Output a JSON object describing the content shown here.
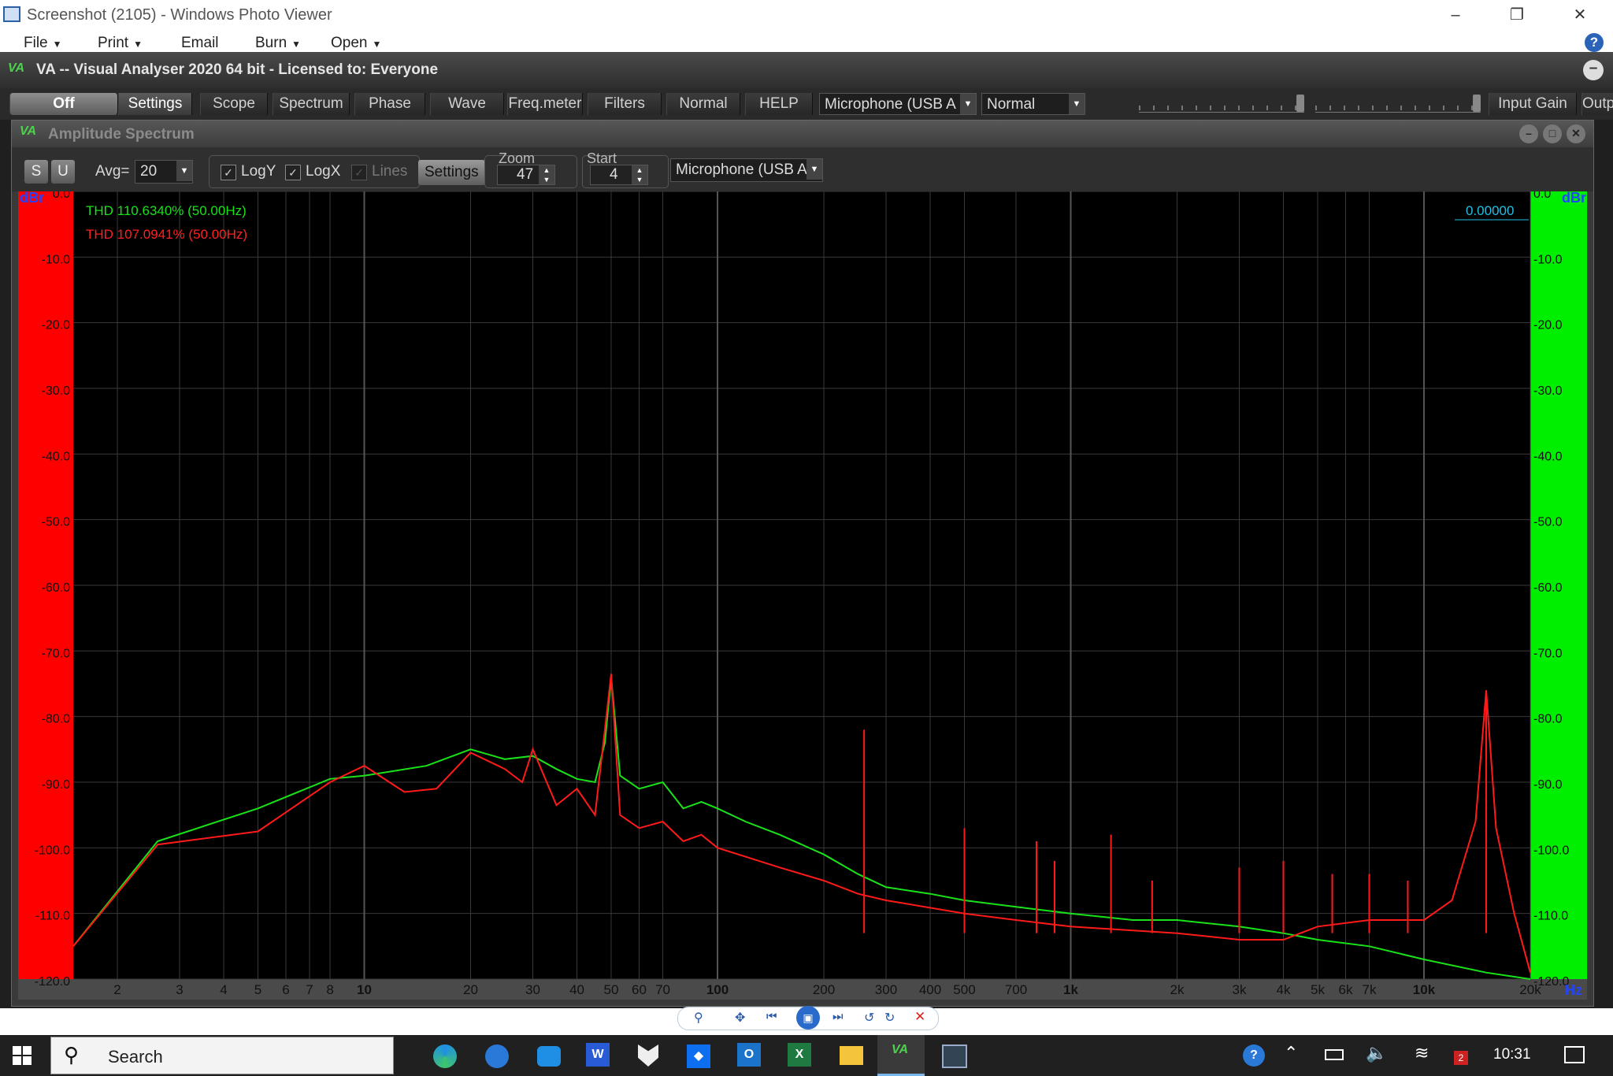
{
  "photo_viewer": {
    "title": "Screenshot (2105) - Windows Photo Viewer",
    "menu": [
      "File",
      "Print",
      "Email",
      "Burn",
      "Open"
    ],
    "help": "?"
  },
  "va": {
    "logo": "VA",
    "title": "VA -- Visual Analyser 2020 64 bit - Licensed to: Everyone",
    "toolbar": {
      "tabs": [
        "Off",
        "Settings",
        "Scope",
        "Spectrum",
        "Phase",
        "Wave",
        "Freq.meter",
        "Filters",
        "Normal",
        "HELP"
      ],
      "input_device": "Microphone (USB A",
      "mode": "Normal",
      "input_gain_label": "Input Gain",
      "output_label": "Outp"
    }
  },
  "spectrum": {
    "title": "Amplitude Spectrum",
    "s_label": "S",
    "u_label": "U",
    "avg_label": "Avg=",
    "avg_value": "20",
    "logy_label": "LogY",
    "logx_label": "LogX",
    "lines_label": "Lines",
    "settings_label": "Settings",
    "zoom_label": "Zoom",
    "zoom_value": "47",
    "start_label": "Start",
    "start_value": "4",
    "device": "Microphone (USB A",
    "left_unit": "dBr",
    "right_unit": "dBr",
    "hz_unit": "Hz",
    "readout": "0.00000",
    "thd_green": "THD 110.6340% (50.00Hz)",
    "thd_red": "THD 107.0941% (50.00Hz)"
  },
  "chart_data": {
    "type": "line",
    "x_scale": "log",
    "y_scale": "dBr",
    "xlim": [
      1.5,
      20000
    ],
    "ylim": [
      -120,
      0
    ],
    "grid": true,
    "y_ticks": [
      "0.0",
      "-10.0",
      "-20.0",
      "-30.0",
      "-40.0",
      "-50.0",
      "-60.0",
      "-70.0",
      "-80.0",
      "-90.0",
      "-100.0",
      "-110.0",
      "-120.0"
    ],
    "x_ticks": [
      {
        "v": 2,
        "label": "2"
      },
      {
        "v": 3,
        "label": "3"
      },
      {
        "v": 4,
        "label": "4"
      },
      {
        "v": 5,
        "label": "5"
      },
      {
        "v": 6,
        "label": "6"
      },
      {
        "v": 7,
        "label": "7"
      },
      {
        "v": 8,
        "label": "8"
      },
      {
        "v": 10,
        "label": "10",
        "bold": true
      },
      {
        "v": 20,
        "label": "20"
      },
      {
        "v": 30,
        "label": "30"
      },
      {
        "v": 40,
        "label": "40"
      },
      {
        "v": 50,
        "label": "50"
      },
      {
        "v": 60,
        "label": "60"
      },
      {
        "v": 70,
        "label": "70"
      },
      {
        "v": 100,
        "label": "100",
        "bold": true
      },
      {
        "v": 200,
        "label": "200"
      },
      {
        "v": 300,
        "label": "300"
      },
      {
        "v": 400,
        "label": "400"
      },
      {
        "v": 500,
        "label": "500"
      },
      {
        "v": 700,
        "label": "700"
      },
      {
        "v": 1000,
        "label": "1k",
        "bold": true
      },
      {
        "v": 2000,
        "label": "2k"
      },
      {
        "v": 3000,
        "label": "3k"
      },
      {
        "v": 4000,
        "label": "4k"
      },
      {
        "v": 5000,
        "label": "5k"
      },
      {
        "v": 6000,
        "label": "6k"
      },
      {
        "v": 7000,
        "label": "7k"
      },
      {
        "v": 10000,
        "label": "10k",
        "bold": true
      },
      {
        "v": 20000,
        "label": "20k"
      }
    ],
    "series": [
      {
        "color": "#19e219",
        "points": [
          [
            1.5,
            -115
          ],
          [
            2.6,
            -99
          ],
          [
            5,
            -94
          ],
          [
            8,
            -89.5
          ],
          [
            10,
            -89
          ],
          [
            15,
            -87.5
          ],
          [
            20,
            -85
          ],
          [
            25,
            -86.5
          ],
          [
            30,
            -86
          ],
          [
            35,
            -88
          ],
          [
            40,
            -89.5
          ],
          [
            45,
            -90
          ],
          [
            48,
            -84
          ],
          [
            50,
            -74
          ],
          [
            53,
            -89
          ],
          [
            60,
            -91
          ],
          [
            70,
            -90
          ],
          [
            80,
            -94
          ],
          [
            90,
            -93
          ],
          [
            100,
            -94
          ],
          [
            120,
            -96
          ],
          [
            150,
            -98
          ],
          [
            200,
            -101
          ],
          [
            250,
            -104
          ],
          [
            300,
            -106
          ],
          [
            400,
            -107
          ],
          [
            500,
            -108
          ],
          [
            700,
            -109
          ],
          [
            1000,
            -110
          ],
          [
            1500,
            -111
          ],
          [
            2000,
            -111
          ],
          [
            3000,
            -112
          ],
          [
            4000,
            -113
          ],
          [
            5000,
            -114
          ],
          [
            7000,
            -115
          ],
          [
            10000,
            -117
          ],
          [
            15000,
            -119
          ],
          [
            20000,
            -120
          ]
        ]
      },
      {
        "color": "#ff1a1a",
        "points": [
          [
            1.5,
            -115
          ],
          [
            2.6,
            -99.5
          ],
          [
            5,
            -97.5
          ],
          [
            8,
            -90
          ],
          [
            10,
            -87.5
          ],
          [
            13,
            -91.5
          ],
          [
            16,
            -91
          ],
          [
            20,
            -85.5
          ],
          [
            25,
            -88
          ],
          [
            28,
            -90
          ],
          [
            30,
            -85
          ],
          [
            35,
            -93.5
          ],
          [
            40,
            -91
          ],
          [
            45,
            -95
          ],
          [
            48,
            -82
          ],
          [
            50,
            -73.5
          ],
          [
            53,
            -95
          ],
          [
            60,
            -97
          ],
          [
            70,
            -96
          ],
          [
            80,
            -99
          ],
          [
            90,
            -98
          ],
          [
            100,
            -100
          ],
          [
            150,
            -103
          ],
          [
            200,
            -105
          ],
          [
            250,
            -107
          ],
          [
            300,
            -108
          ],
          [
            500,
            -110
          ],
          [
            700,
            -111
          ],
          [
            1000,
            -112
          ],
          [
            2000,
            -113
          ],
          [
            3000,
            -114
          ],
          [
            4000,
            -114
          ],
          [
            5000,
            -112
          ],
          [
            7000,
            -111
          ],
          [
            10000,
            -111
          ],
          [
            12000,
            -108
          ],
          [
            14000,
            -96
          ],
          [
            15000,
            -76
          ],
          [
            16000,
            -97
          ],
          [
            18000,
            -110
          ],
          [
            20000,
            -119
          ]
        ]
      }
    ],
    "spikes": [
      [
        260,
        -82
      ],
      [
        500,
        -97
      ],
      [
        800,
        -99
      ],
      [
        900,
        -102
      ],
      [
        1300,
        -98
      ],
      [
        1700,
        -105
      ],
      [
        3000,
        -103
      ],
      [
        4000,
        -102
      ],
      [
        5500,
        -104
      ],
      [
        7000,
        -104
      ],
      [
        9000,
        -105
      ],
      [
        15000,
        -76
      ]
    ]
  },
  "photo_viewer_controls": [
    "zoom",
    "fit",
    "previous",
    "slideshow",
    "next",
    "rotate-left",
    "rotate-right",
    "delete"
  ],
  "taskbar": {
    "search_placeholder": "Search",
    "clock": "10:31",
    "notification_count": "2"
  }
}
